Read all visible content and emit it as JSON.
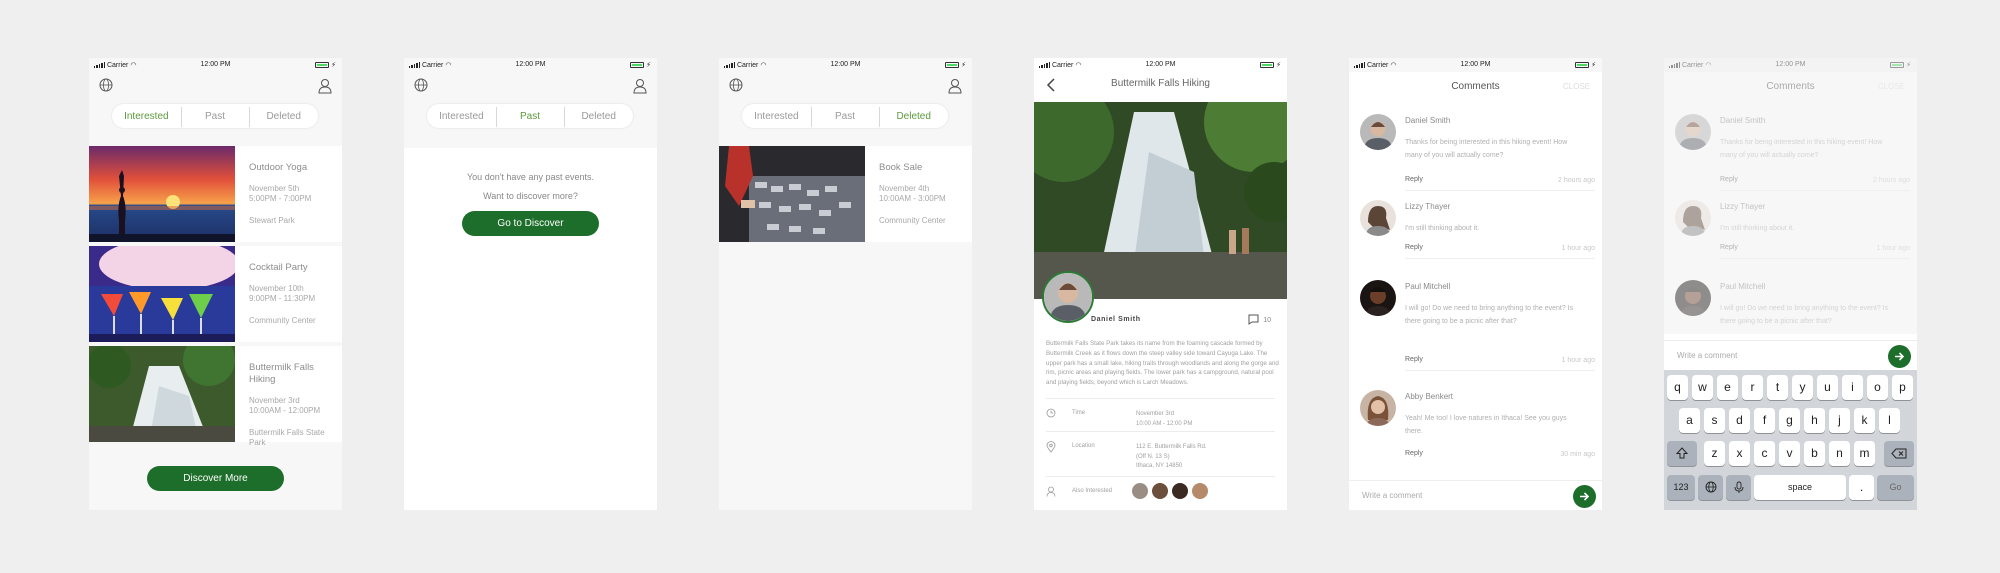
{
  "status": {
    "carrier": "Carrier",
    "time": "12:00 PM"
  },
  "tabs": {
    "interested": "Interested",
    "past": "Past",
    "deleted": "Deleted"
  },
  "colors": {
    "accent": "#1d6e2a",
    "active_tab": "#5e9a3e"
  },
  "icons": {
    "globe": "globe-icon",
    "user": "user-icon",
    "back": "chevron-left-icon",
    "send": "arrow-right-icon"
  },
  "screen1": {
    "events": [
      {
        "title": "Outdoor Yoga",
        "date": "November 5th",
        "time": "5:00PM - 7:00PM",
        "location": "Stewart Park"
      },
      {
        "title": "Cocktail Party",
        "date": "November 10th",
        "time": "9:00PM - 11:30PM",
        "location": "Community Center"
      },
      {
        "title": "Buttermilk Falls Hiking",
        "date": "November 3rd",
        "time": "10:00AM - 12:00PM",
        "location": "Buttermilk Falls State Park"
      }
    ],
    "button": "Discover More"
  },
  "screen2": {
    "line1": "You don't have any past events.",
    "line2": "Want to discover more?",
    "button": "Go to Discover"
  },
  "screen3": {
    "event": {
      "title": "Book Sale",
      "date": "November 4th",
      "time": "10:00AM - 3:00PM",
      "location": "Community Center"
    }
  },
  "screen4": {
    "title": "Buttermilk Falls Hiking",
    "author": "Daniel Smith",
    "comment_count": "10",
    "description": "Buttermilk Falls State Park takes its name from the foaming cascade formed by Buttermilk Creek as it flows down the steep valley side toward Cayuga Lake. The upper park has a small lake, hiking trails through woodlands and along the gorge and rim, picnic areas and playing fields. The lower park has a campground, natural pool and playing fields, beyond which is Larch Meadows.",
    "time_label": "Time",
    "time_value_1": "November 3rd",
    "time_value_2": "10:00 AM - 12:00 PM",
    "location_label": "Location",
    "location_value_1": "112 E. Buttermilk Falls Rd.",
    "location_value_2": "(Off N. 13 S)",
    "location_value_3": "Ithaca, NY 14850",
    "interested_label": "Also Interested"
  },
  "comments_screen": {
    "header": "Comments",
    "close": "CLOSE",
    "reply": "Reply",
    "input_placeholder": "Write a comment",
    "comments": [
      {
        "name": "Daniel Smith",
        "text": "Thanks for being interested in this hiking event! How many of you will actually come?",
        "time": "2 hours ago"
      },
      {
        "name": "Lizzy Thayer",
        "text": "I'm still thinking about it.",
        "time": "1 hour ago"
      },
      {
        "name": "Paul Mitchell",
        "text": "I will go! Do we need to bring anything to the event? Is there going to be a picnic after that?",
        "time": "1 hour ago"
      },
      {
        "name": "Abby Benkert",
        "text": "Yeah! Me too! I love natures in Ithaca! See you guys there.",
        "time": "30 min ago"
      }
    ]
  },
  "keyboard": {
    "row1": [
      "q",
      "w",
      "e",
      "r",
      "t",
      "y",
      "u",
      "i",
      "o",
      "p"
    ],
    "row2": [
      "a",
      "s",
      "d",
      "f",
      "g",
      "h",
      "j",
      "k",
      "l"
    ],
    "row3": [
      "z",
      "x",
      "c",
      "v",
      "b",
      "n",
      "m"
    ],
    "num": "123",
    "space": "space",
    "period": ".",
    "go": "Go"
  }
}
